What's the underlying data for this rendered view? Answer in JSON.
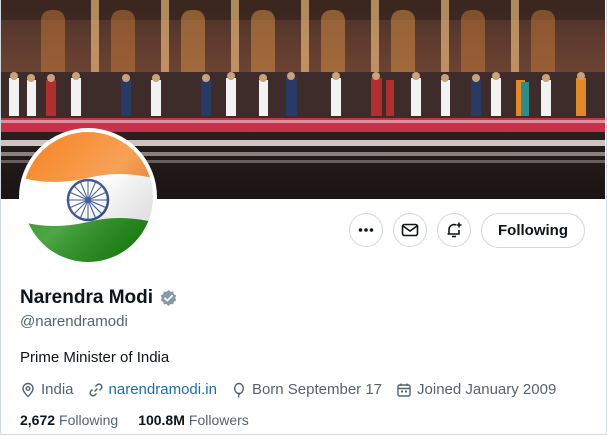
{
  "profile": {
    "display_name": "Narendra Modi",
    "handle": "@narendramodi",
    "bio": "Prime Minister of India",
    "location": "India",
    "website": "narendramodi.in",
    "born": "Born September 17",
    "joined": "Joined January 2009"
  },
  "stats": {
    "following_count": "2,672",
    "following_label": "Following",
    "followers_count": "100.8M",
    "followers_label": "Followers"
  },
  "actions": {
    "follow_label": "Following"
  },
  "icons": {
    "more": "more-icon",
    "message": "mail-icon",
    "notify": "bell-plus-icon",
    "verified": "verified-badge-icon",
    "location": "location-pin-icon",
    "link": "link-icon",
    "birthday": "balloon-icon",
    "calendar": "calendar-icon"
  },
  "colors": {
    "saffron": "#f58220",
    "green": "#138808",
    "navy": "#0b2c7a",
    "link": "#1d6fa3",
    "muted": "#536471"
  }
}
